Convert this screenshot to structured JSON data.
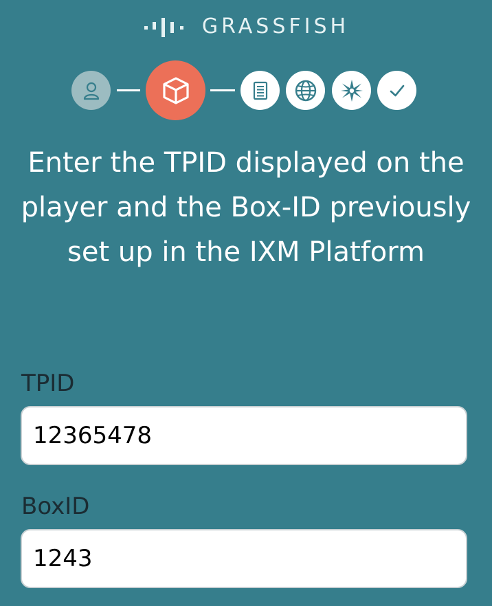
{
  "brand": {
    "name": "GRASSFISH",
    "text_color": "#e6f2f3"
  },
  "theme": {
    "background": "#367e8c",
    "active_step_color": "#ec7058",
    "completed_step_color": "#9cbcc1",
    "icon_color": "#367e8c"
  },
  "stepper": {
    "active_index": 1,
    "steps": [
      {
        "icon": "user-icon",
        "state": "completed"
      },
      {
        "icon": "box-icon",
        "state": "active"
      },
      {
        "icon": "document-icon",
        "state": "pending"
      },
      {
        "icon": "globe-icon",
        "state": "pending"
      },
      {
        "icon": "compass-icon",
        "state": "pending"
      },
      {
        "icon": "checkmark-icon",
        "state": "pending"
      }
    ]
  },
  "instructions": {
    "text": "Enter the TPID displayed on the player and the Box-ID previously set up in the IXM Platform"
  },
  "form": {
    "tpid": {
      "label": "TPID",
      "value": "12365478"
    },
    "boxid": {
      "label": "BoxID",
      "value": "1243"
    }
  }
}
